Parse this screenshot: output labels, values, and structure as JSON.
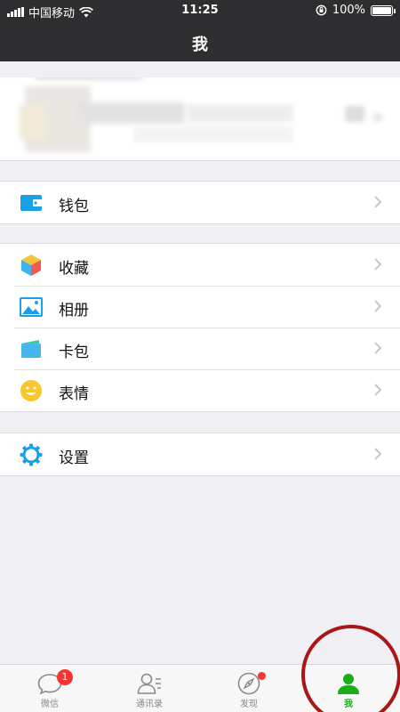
{
  "status_bar": {
    "carrier": "中国移动",
    "time": "11:25",
    "battery": "100%"
  },
  "nav": {
    "title": "我"
  },
  "groups": {
    "wallet": [
      {
        "label": "钱包",
        "icon": "wallet-icon"
      }
    ],
    "main": [
      {
        "label": "收藏",
        "icon": "favorites-cube-icon"
      },
      {
        "label": "相册",
        "icon": "photo-album-icon"
      },
      {
        "label": "卡包",
        "icon": "card-pack-icon"
      },
      {
        "label": "表情",
        "icon": "smiley-icon"
      }
    ],
    "settings": [
      {
        "label": "设置",
        "icon": "gear-icon"
      }
    ]
  },
  "tabbar": {
    "tabs": [
      {
        "label": "微信",
        "icon": "chat-bubble-icon",
        "badge": "1"
      },
      {
        "label": "通讯录",
        "icon": "contacts-icon"
      },
      {
        "label": "发现",
        "icon": "compass-icon",
        "dot": true
      },
      {
        "label": "我",
        "icon": "person-icon",
        "active": true
      }
    ]
  },
  "colors": {
    "header_bg": "#2e2e30",
    "active_tab": "#1aad19",
    "badge": "#f43530",
    "annotation_circle": "#a91616"
  }
}
